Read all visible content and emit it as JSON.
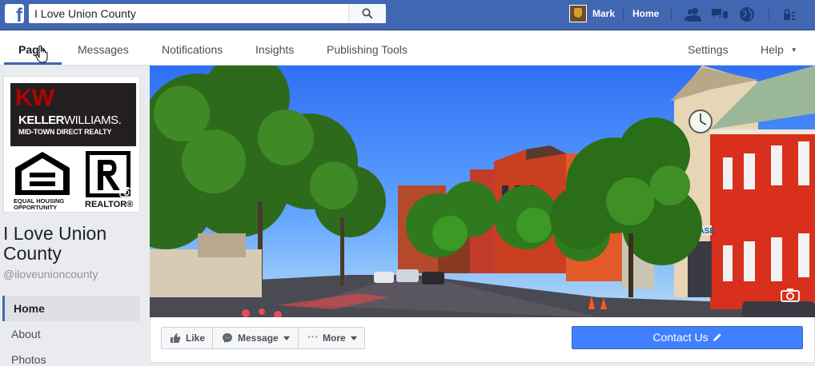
{
  "topbar": {
    "search_value": "I Love Union County",
    "user_name": "Mark",
    "home_label": "Home",
    "icons": [
      "friend-requests-icon",
      "messages-icon",
      "notifications-globe-icon",
      "privacy-shortcuts-icon"
    ]
  },
  "page_nav": {
    "tabs": [
      "Page",
      "Messages",
      "Notifications",
      "Insights",
      "Publishing Tools"
    ],
    "active_tab": "Page",
    "right": {
      "settings": "Settings",
      "help": "Help"
    }
  },
  "profile_picture": {
    "logo_text": "KW",
    "brand_bold": "KELLER",
    "brand_thin": "WILLIAMS.",
    "brand_sub": "MID-TOWN DIRECT REALTY",
    "equal_housing": [
      "EQUAL HOUSING",
      "OPPORTUNITY"
    ],
    "realtor": "REALTOR®"
  },
  "page_info": {
    "title": "I Love Union County",
    "handle": "@iloveunioncounty"
  },
  "side_nav": [
    "Home",
    "About",
    "Photos"
  ],
  "cover": {
    "sign_text": "CHASE"
  },
  "actions": {
    "like": "Like",
    "message": "Message",
    "more": "More",
    "contact": "Contact Us"
  },
  "colors": {
    "facebook_blue": "#4267b2",
    "cta_blue": "#4080ff",
    "page_background": "#e9ebee"
  }
}
